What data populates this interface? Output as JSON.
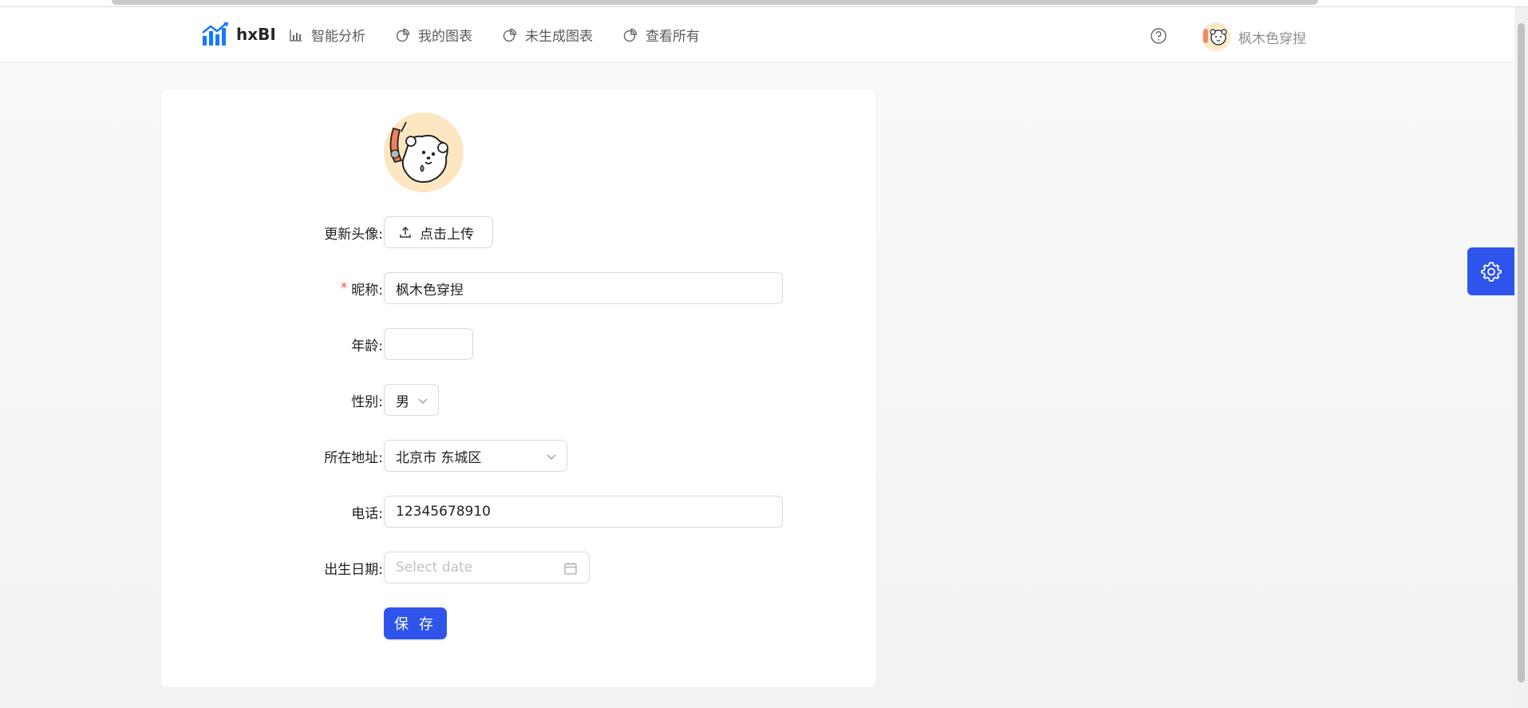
{
  "header": {
    "brand": "hxBI",
    "nav": [
      {
        "label": "智能分析",
        "icon": "bar-chart-icon"
      },
      {
        "label": "我的图表",
        "icon": "pie-chart-icon"
      },
      {
        "label": "未生成图表",
        "icon": "pie-chart-icon"
      },
      {
        "label": "查看所有",
        "icon": "pie-chart-icon"
      }
    ],
    "help_icon": "question-circle-icon",
    "user_name": "枫木色穿揑"
  },
  "form": {
    "avatar_label": "更新头像:",
    "upload_label": "点击上传",
    "nickname_label": "昵称:",
    "nickname_value": "枫木色穿揑",
    "age_label": "年龄:",
    "age_value": "",
    "gender_label": "性别:",
    "gender_value": "男",
    "address_label": "所在地址:",
    "address_value": "北京市 东城区",
    "phone_label": "电话:",
    "phone_value": "12345678910",
    "birthday_label": "出生日期:",
    "birthday_placeholder": "Select date",
    "save_label": "保 存"
  },
  "colors": {
    "primary": "#2f54eb",
    "required": "#ff4d4f",
    "brand_icon": "#1677ff"
  }
}
